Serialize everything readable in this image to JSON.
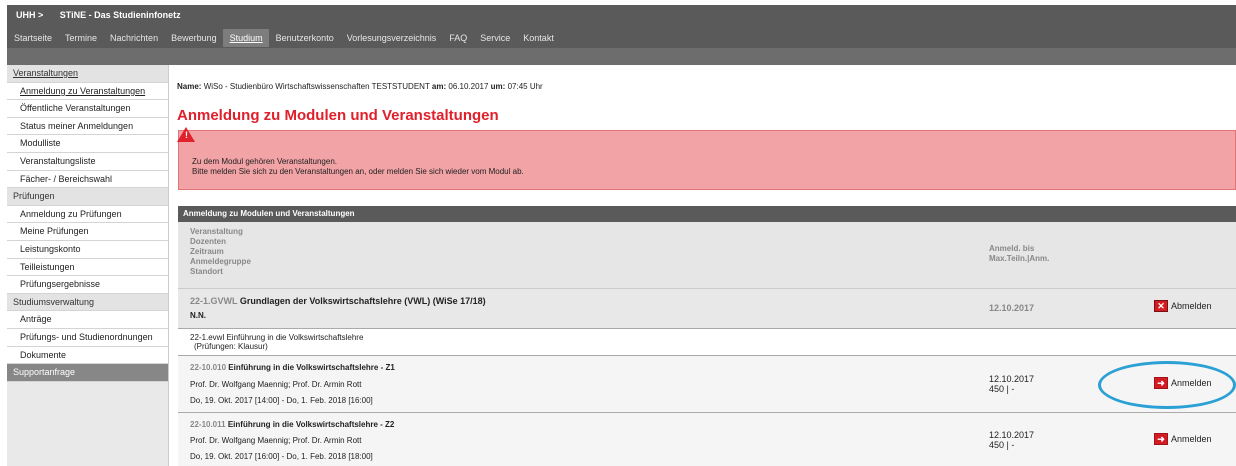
{
  "brand": {
    "uhh": "UHH >",
    "title": "STiNE - Das Studieninfonetz"
  },
  "nav": [
    "Startseite",
    "Termine",
    "Nachrichten",
    "Bewerbung",
    "Studium",
    "Benutzerkonto",
    "Vorlesungsverzeichnis",
    "FAQ",
    "Service",
    "Kontakt"
  ],
  "sidebar": [
    "Veranstaltungen",
    "Anmeldung zu Veranstaltungen",
    "Öffentliche Veranstaltungen",
    "Status meiner Anmeldungen",
    "Modulliste",
    "Veranstaltungsliste",
    "Fächer- / Bereichswahl",
    "Prüfungen",
    "Anmeldung zu Prüfungen",
    "Meine Prüfungen",
    "Leistungskonto",
    "Teilleistungen",
    "Prüfungsergebnisse",
    "Studiumsverwaltung",
    "Anträge",
    "Prüfungs- und Studienordnungen",
    "Dokumente",
    "Supportanfrage"
  ],
  "nameline": {
    "label_name": "Name:",
    "name": "WiSo - Studienbüro Wirtschaftswissenschaften TESTSTUDENT",
    "label_am": "am:",
    "date": "06.10.2017",
    "label_um": "um:",
    "time": "07:45 Uhr"
  },
  "page_title": "Anmeldung zu Modulen und Veranstaltungen",
  "alert": {
    "line1": "Zu dem Modul gehören Veranstaltungen.",
    "line2": "Bitte melden Sie sich zu den Veranstaltungen an, oder melden Sie sich wieder vom Modul ab."
  },
  "table": {
    "title": "Anmeldung zu Modulen und Veranstaltungen",
    "col_left": [
      "Veranstaltung",
      "Dozenten",
      "Zeitraum",
      "Anmeldegruppe",
      "Standort"
    ],
    "col_right": [
      "Anmeld. bis",
      "Max.Teiln.|Anm."
    ],
    "module": {
      "code": "22-1.GVWL",
      "title": "Grundlagen der Volkswirtschaftslehre (VWL) (WiSe 17/18)",
      "lecturer": "N.N.",
      "deadline": "12.10.2017",
      "action": "Abmelden"
    },
    "info": {
      "line1": "22-1.evwl Einführung in die Volkswirtschaftslehre",
      "line2": "(Prüfungen: Klausur)"
    },
    "courses": [
      {
        "code": "22-10.010",
        "title": "Einführung in die Volkswirtschaftslehre - Z1",
        "lecturers": "Prof. Dr. Wolfgang Maennig; Prof. Dr. Armin Rott",
        "period": "Do, 19. Okt. 2017 [14:00] - Do, 1. Feb. 2018 [16:00]",
        "deadline": "12.10.2017",
        "capacity": "450 | -",
        "action": "Anmelden"
      },
      {
        "code": "22-10.011",
        "title": "Einführung in die Volkswirtschaftslehre - Z2",
        "lecturers": "Prof. Dr. Wolfgang Maennig; Prof. Dr. Armin Rott",
        "period": "Do, 19. Okt. 2017 [16:00] - Do, 1. Feb. 2018 [18:00]",
        "deadline": "12.10.2017",
        "capacity": "450 | -",
        "action": "Anmelden"
      }
    ]
  }
}
